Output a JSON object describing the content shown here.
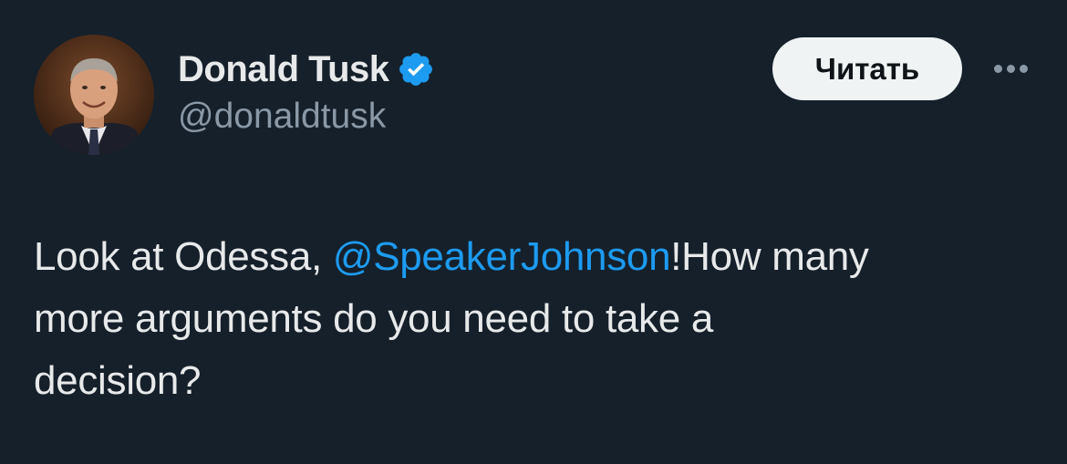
{
  "author": {
    "display_name": "Donald Tusk",
    "handle": "@donaldtusk",
    "verified": true,
    "avatar_icon": "profile-photo"
  },
  "actions": {
    "follow_label": "Читать",
    "more_icon": "more-options-icon"
  },
  "tweet": {
    "line1_pre": "Look at Odessa, ",
    "mention": "@SpeakerJohnson",
    "line1_post": "!How many",
    "line2": "more arguments do you need to take a",
    "line3": "decision?"
  },
  "colors": {
    "background": "#15202b",
    "text": "#e7e9ea",
    "secondary_text": "#8b98a5",
    "accent": "#1d9bf0",
    "button_bg": "#eff3f4"
  }
}
